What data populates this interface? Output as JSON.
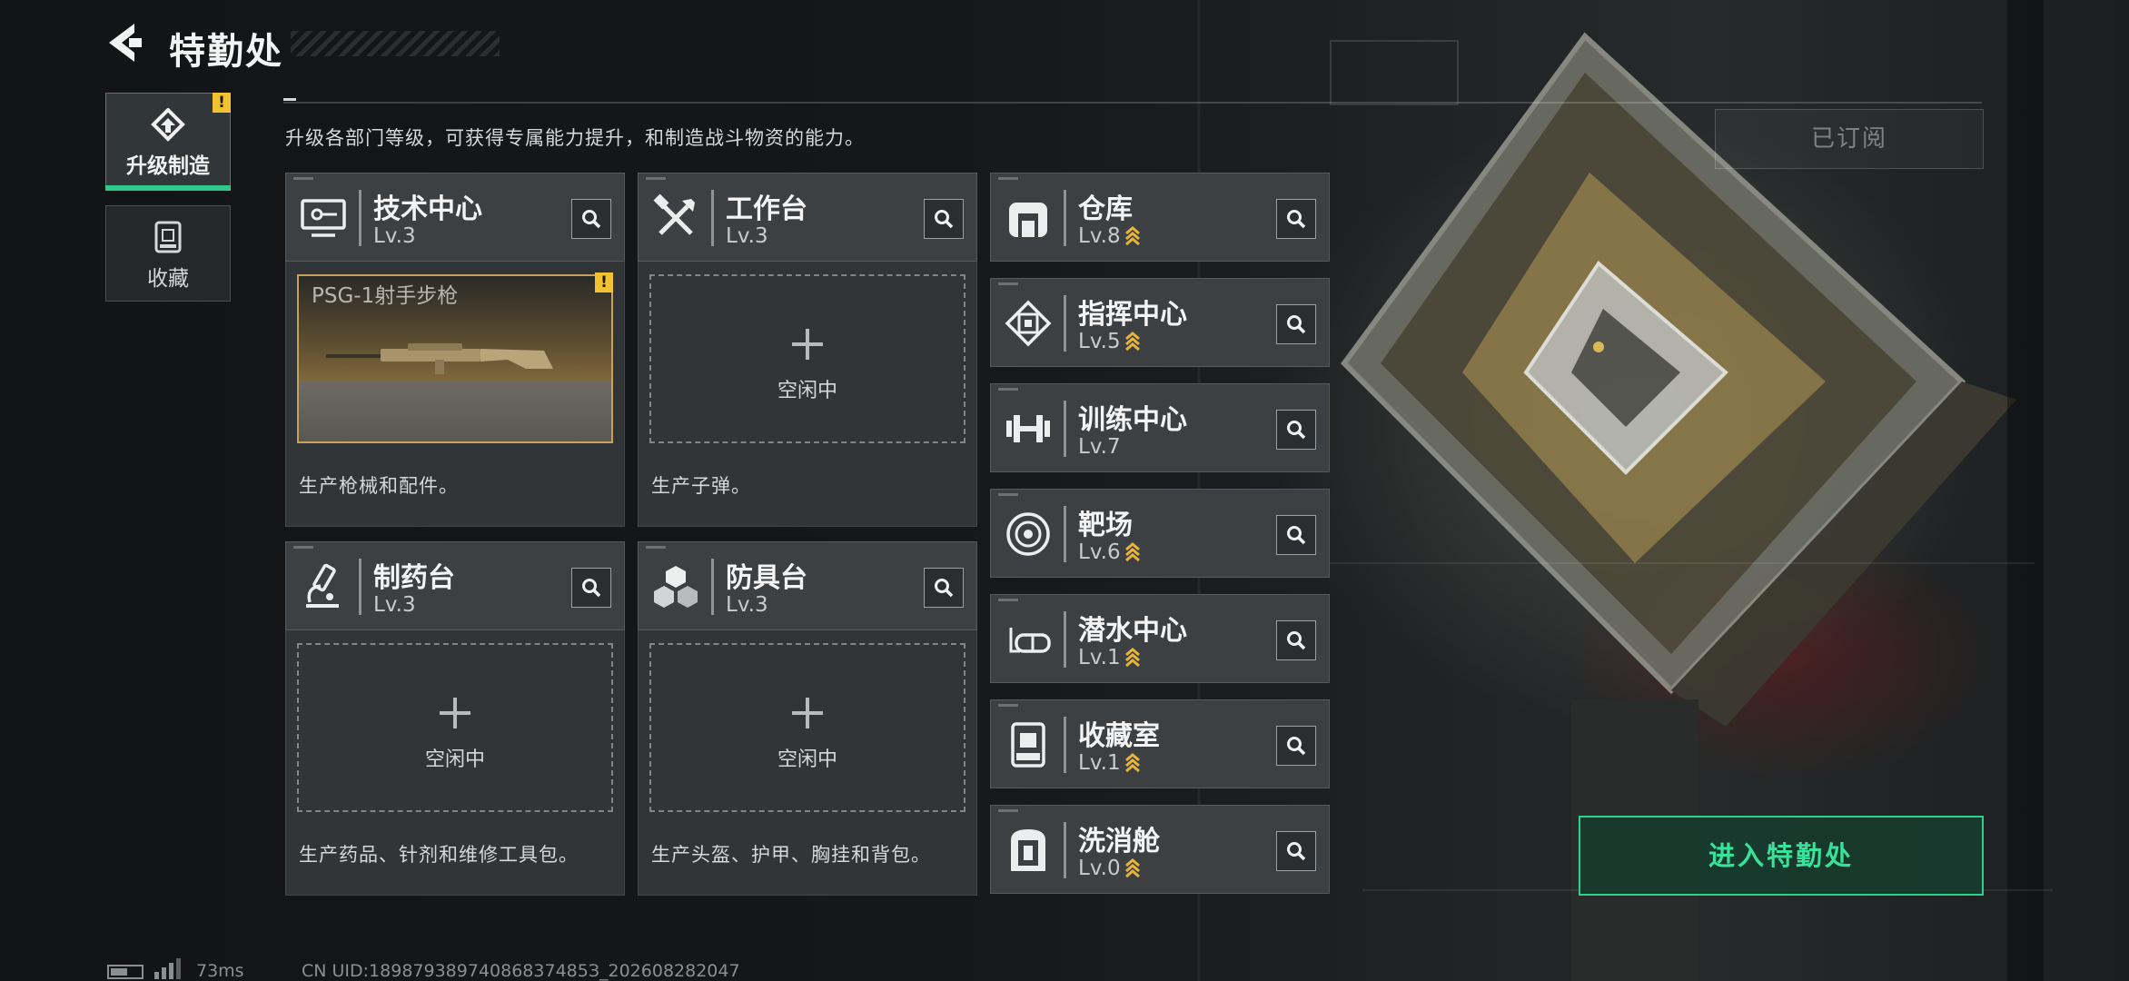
{
  "header": {
    "title": "特勤处"
  },
  "tabs": [
    {
      "label": "升级制造",
      "active": true,
      "alert": "!"
    },
    {
      "label": "收藏",
      "active": false
    }
  ],
  "description": "升级各部门等级，可获得专属能力提升，和制造战斗物资的能力。",
  "subscribed_label": "已订阅",
  "production_facilities": [
    {
      "name": "技术中心",
      "level": "Lv.3",
      "icon": "monitor-icon",
      "slot": {
        "state": "producing",
        "item": "PSG-1射手步枪",
        "alert": "!"
      },
      "desc": "生产枪械和配件。"
    },
    {
      "name": "工作台",
      "level": "Lv.3",
      "icon": "tools-icon",
      "slot": {
        "state": "idle",
        "text": "空闲中"
      },
      "desc": "生产子弹。"
    },
    {
      "name": "制药台",
      "level": "Lv.3",
      "icon": "microscope-icon",
      "slot": {
        "state": "idle",
        "text": "空闲中"
      },
      "desc": "生产药品、针剂和维修工具包。"
    },
    {
      "name": "防具台",
      "level": "Lv.3",
      "icon": "blocks-icon",
      "slot": {
        "state": "idle",
        "text": "空闲中"
      },
      "desc": "生产头盔、护甲、胸挂和背包。"
    }
  ],
  "facilities": [
    {
      "name": "仓库",
      "level": "Lv.8",
      "icon": "warehouse-icon",
      "upgradable": true
    },
    {
      "name": "指挥中心",
      "level": "Lv.5",
      "icon": "chip-icon",
      "upgradable": true
    },
    {
      "name": "训练中心",
      "level": "Lv.7",
      "icon": "dumbbell-icon",
      "upgradable": false
    },
    {
      "name": "靶场",
      "level": "Lv.6",
      "icon": "target-icon",
      "upgradable": true
    },
    {
      "name": "潜水中心",
      "level": "Lv.1",
      "icon": "diving-mask-icon",
      "upgradable": true
    },
    {
      "name": "收藏室",
      "level": "Lv.1",
      "icon": "display-case-icon",
      "upgradable": true
    },
    {
      "name": "洗消舱",
      "level": "Lv.0",
      "icon": "decon-chamber-icon",
      "upgradable": true
    }
  ],
  "enter_button": "进入特勤处",
  "status": {
    "ping": "73ms",
    "uid": "CN UID:18987938974086837485З_202608282047"
  },
  "colors": {
    "accent_green": "#2bd18d",
    "alert_yellow": "#f2c230",
    "upgrade_gold": "#e8b43a"
  }
}
